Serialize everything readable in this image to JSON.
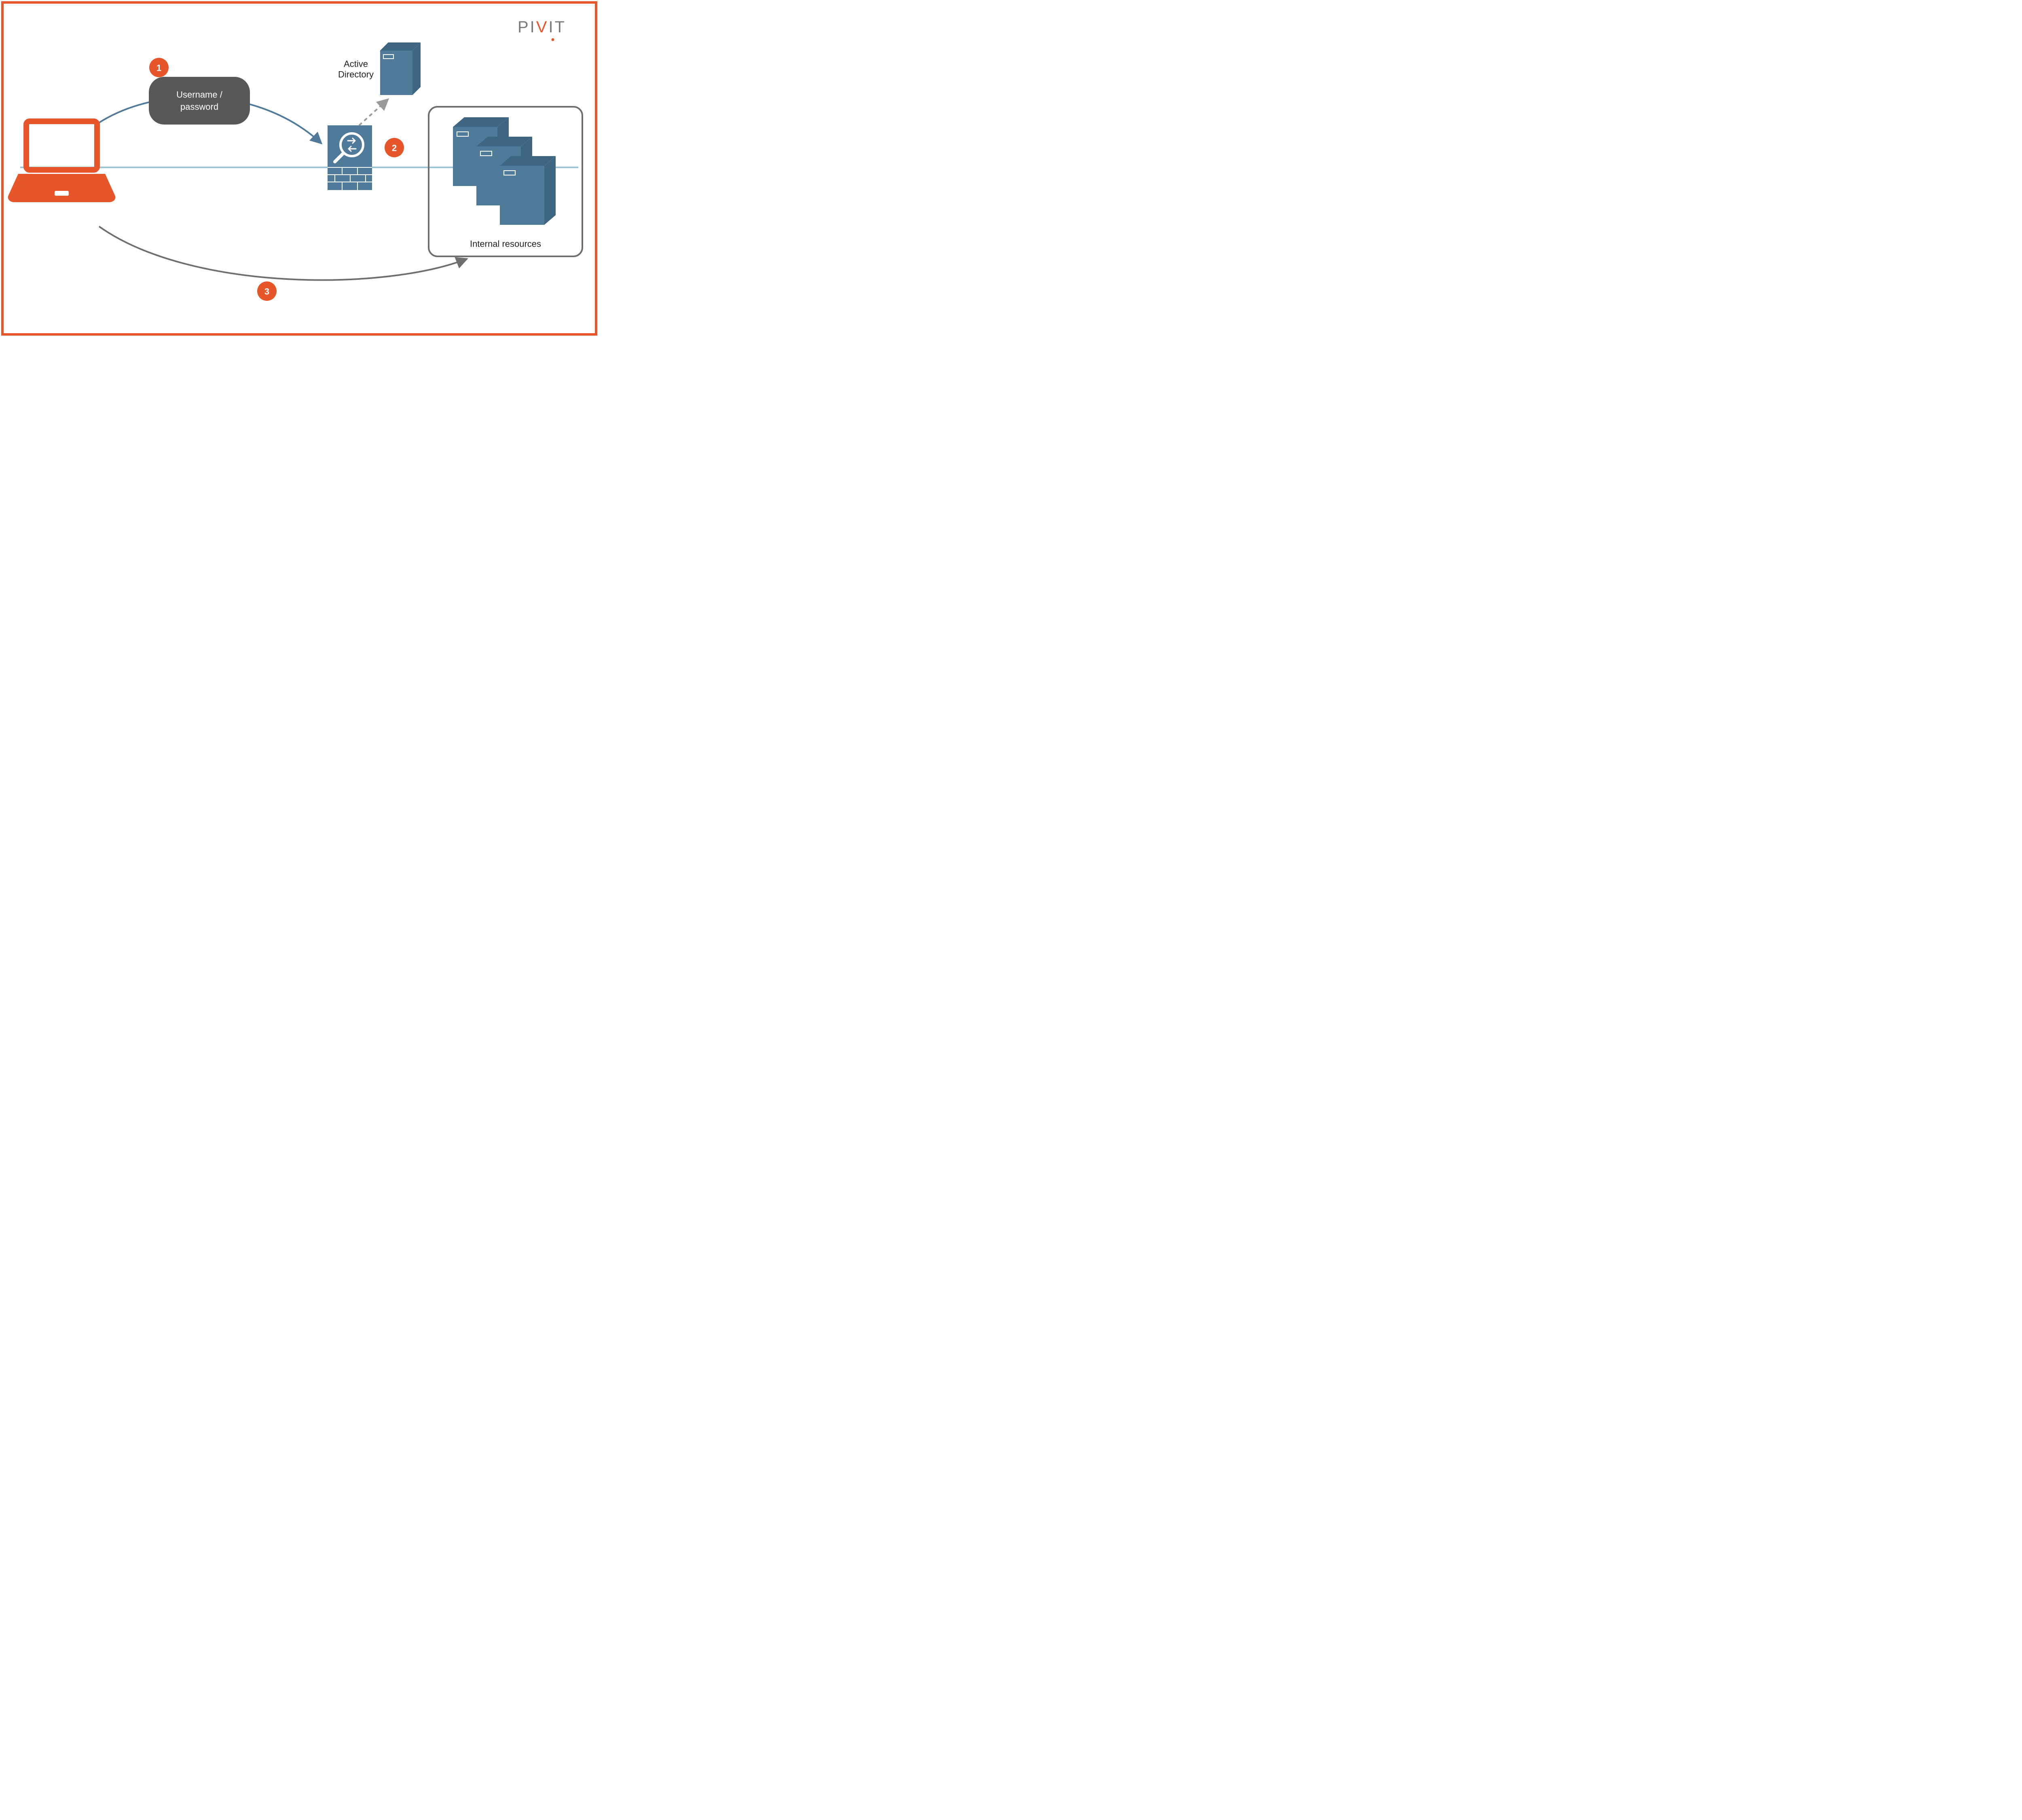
{
  "brand": {
    "name": "PIVIT",
    "accent": "#E7562B",
    "gray": "#7A7A7A"
  },
  "colors": {
    "orange": "#E7562B",
    "dark_gray": "#585858",
    "blue": "#4F7A9A",
    "blue_dark": "#3E6582",
    "light_blue": "#9CC6D6",
    "outline_gray": "#6E6E6E"
  },
  "steps": {
    "one": "1",
    "two": "2",
    "three": "3"
  },
  "labels": {
    "username_line1": "Username /",
    "username_line2": "password",
    "active_directory_line1": "Active",
    "active_directory_line2": "Directory",
    "internal_resources": "Internal resources"
  },
  "icons": {
    "laptop": "laptop-icon",
    "firewall": "firewall-inspect-icon",
    "ad_server": "server-icon",
    "servers": "server-cluster-icon"
  }
}
